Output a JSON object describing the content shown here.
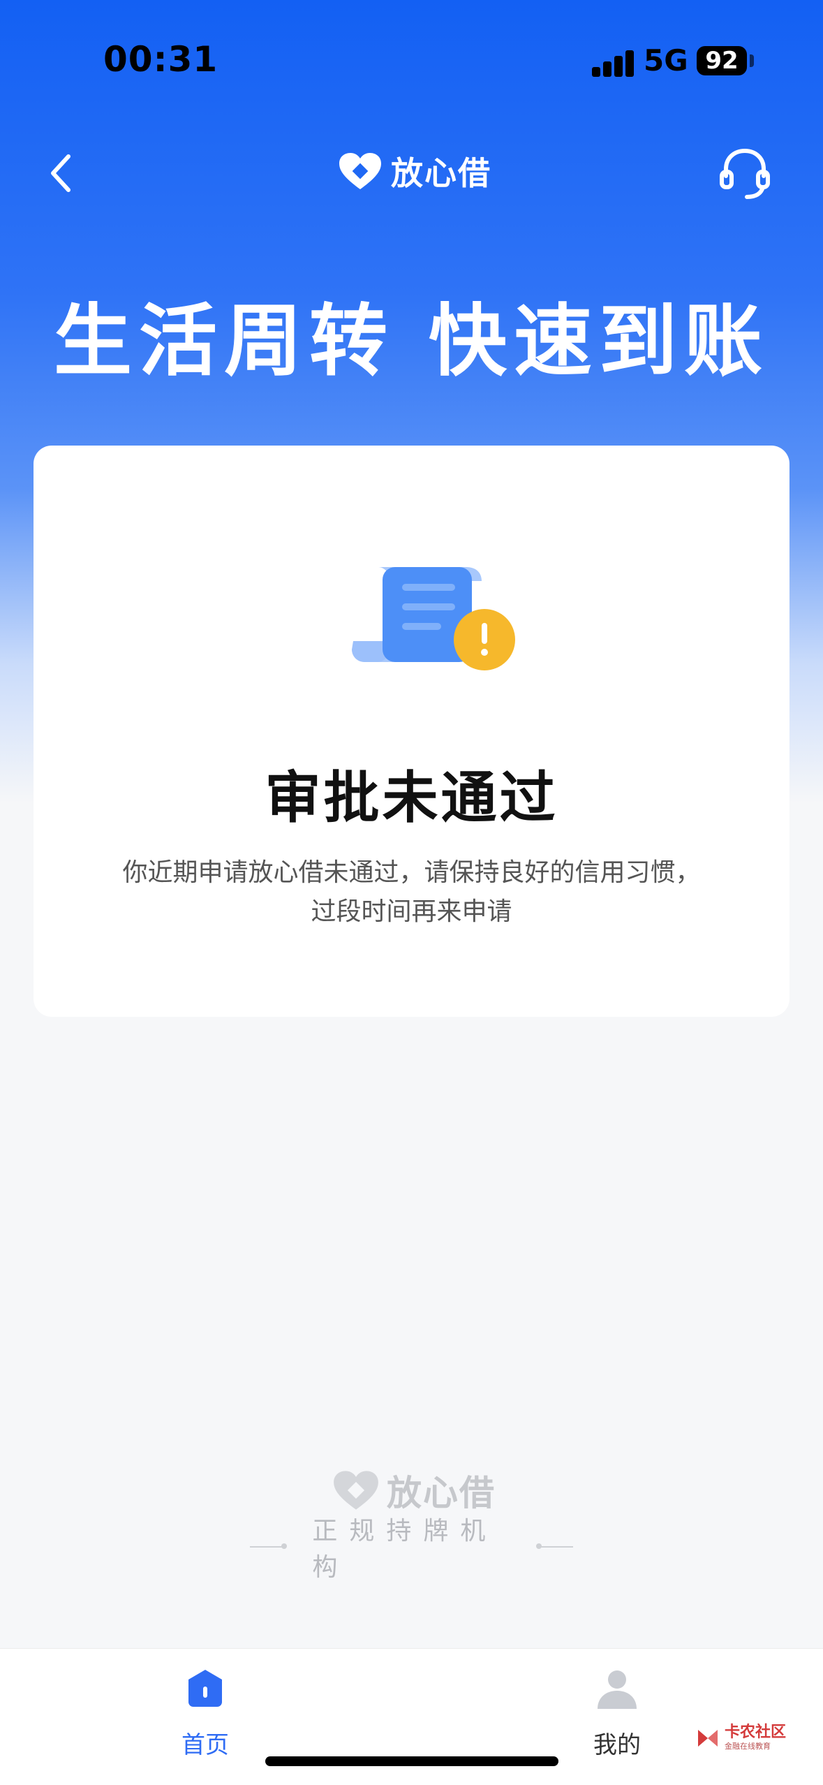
{
  "status_bar": {
    "time": "00:31",
    "network": "5G",
    "battery": "92"
  },
  "nav": {
    "brand_name": "放心借"
  },
  "hero": {
    "title": "生活周转 快速到账"
  },
  "result_card": {
    "title": "审批未通过",
    "description_line1": "你近期申请放心借未通过，请保持良好的信用习惯，",
    "description_line2": "过段时间再来申请"
  },
  "footer": {
    "brand_name": "放心借",
    "license": "正规持牌机构"
  },
  "tabbar": {
    "tabs": [
      {
        "label": "首页",
        "active": true
      },
      {
        "label": "我的",
        "active": false
      }
    ]
  },
  "watermark": {
    "text": "卡农社区",
    "subtext": "金融在线教育"
  },
  "colors": {
    "brand_blue": "#1360f3",
    "active_tab": "#2f6cf4",
    "warning": "#f6b82c"
  }
}
